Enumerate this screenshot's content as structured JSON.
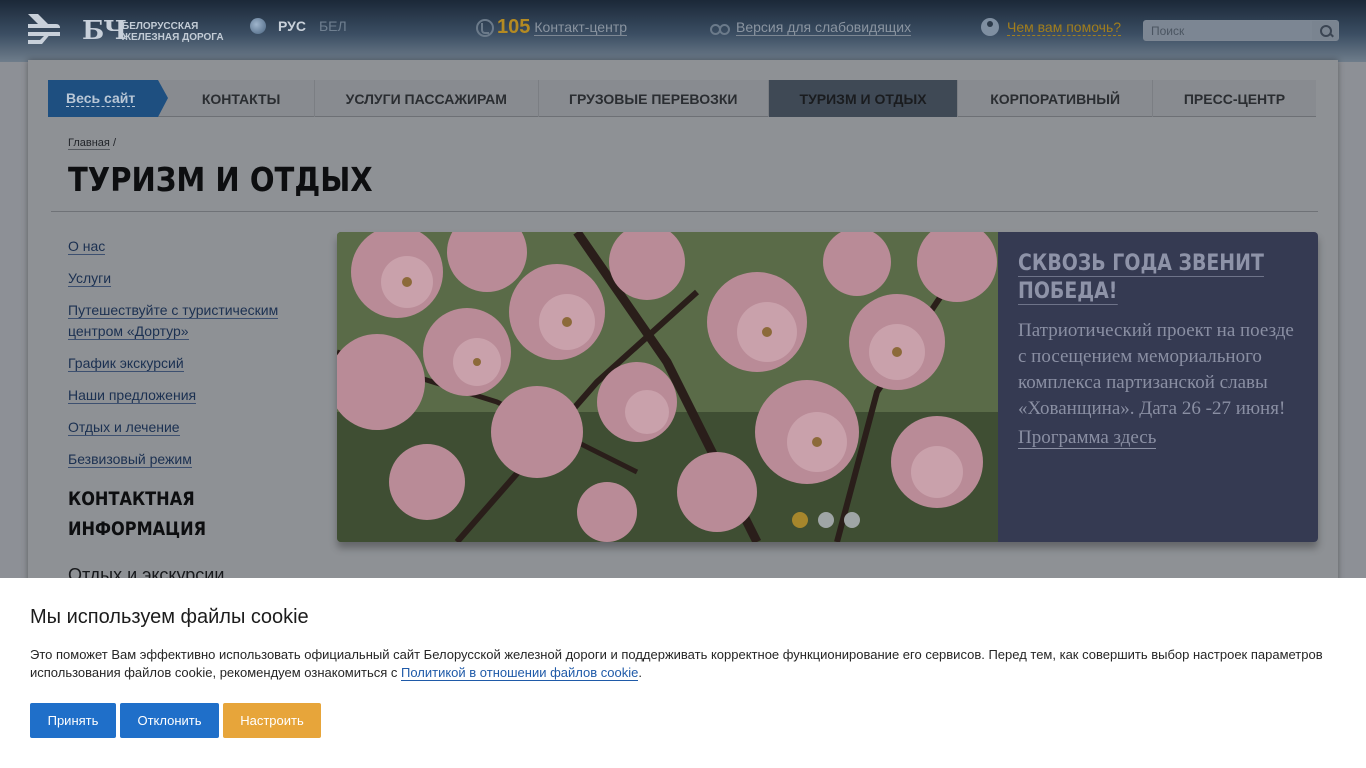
{
  "header": {
    "logo_mark": "БЧ",
    "logo_line1": "Белорусская",
    "logo_line2": "железная дорога",
    "lang_active": "РУС",
    "lang_inactive": "БЕЛ",
    "phone_number": "105",
    "contact_center": "Контакт-центр",
    "vision_link": "Версия для слабовидящих",
    "help_link": "Чем вам помочь?",
    "search_placeholder": "Поиск"
  },
  "nav": {
    "all_site": "Весь сайт",
    "items": [
      {
        "label": "КОНТАКТЫ",
        "active": false
      },
      {
        "label": "УСЛУГИ ПАССАЖИРАМ",
        "active": false
      },
      {
        "label": "ГРУЗОВЫЕ ПЕРЕВОЗКИ",
        "active": false
      },
      {
        "label": "ТУРИЗМ И ОТДЫХ",
        "active": true
      },
      {
        "label": "КОРПОРАТИВНЫЙ",
        "active": false
      },
      {
        "label": "ПРЕСС-ЦЕНТР",
        "active": false
      }
    ]
  },
  "breadcrumb": {
    "home": "Главная",
    "separator": "/"
  },
  "page_title": "ТУРИЗМ И ОТДЫХ",
  "sidebar": {
    "items": [
      "О нас",
      "Услуги",
      "Путешествуйте с туристическим центром «Дортур»",
      "График экскурсий",
      "Наши предложения",
      "Отдых и лечение",
      "Безвизовый режим"
    ],
    "contact_heading": "КОНТАКТНАЯ ИНФОРМАЦИЯ",
    "contact_sub": "Отдых и экскурсии"
  },
  "slider": {
    "title": "СКВОЗЬ ГОДА ЗВЕНИТ ПОБЕДА!",
    "description": "Патриотический проект на поезде с посещением мемориального комплекса партизанской славы «Хованщина». Дата  26 -27 июня!",
    "link": "Программа здесь",
    "slide_count": 3,
    "active_slide": 1
  },
  "cookie": {
    "title": "Мы используем файлы cookie",
    "text_before": "Это поможет Вам эффективно использовать официальный сайт Белорусской железной дороги и поддерживать корректное функционирование его сервисов. Перед тем, как совершить выбор настроек параметров использования файлов cookie, рекомендуем ознакомиться с ",
    "policy_link": "Политикой в отношении файлов cookie",
    "text_after": ".",
    "accept": "Принять",
    "decline": "Отклонить",
    "settings": "Настроить"
  },
  "colors": {
    "accent_blue": "#1f6fc9",
    "accent_orange": "#e7a53a",
    "header_dark": "#1b2838"
  }
}
